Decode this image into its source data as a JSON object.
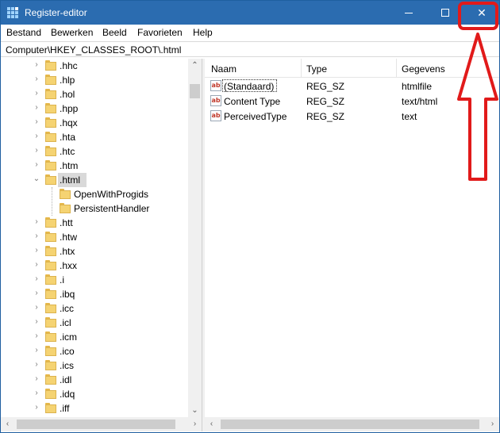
{
  "window": {
    "title": "Register-editor"
  },
  "titlebar": {
    "minimize_glyph": "",
    "maximize_glyph": "",
    "close_glyph": "✕"
  },
  "menu": {
    "items": [
      {
        "label": "Bestand"
      },
      {
        "label": "Bewerken"
      },
      {
        "label": "Beeld"
      },
      {
        "label": "Favorieten"
      },
      {
        "label": "Help"
      }
    ]
  },
  "address": {
    "path": "Computer\\HKEY_CLASSES_ROOT\\.html"
  },
  "tree": {
    "items": [
      {
        "label": ".hhc",
        "expander": "›"
      },
      {
        "label": ".hlp",
        "expander": "›"
      },
      {
        "label": ".hol",
        "expander": "›"
      },
      {
        "label": ".hpp",
        "expander": "›"
      },
      {
        "label": ".hqx",
        "expander": "›"
      },
      {
        "label": ".hta",
        "expander": "›"
      },
      {
        "label": ".htc",
        "expander": "›"
      },
      {
        "label": ".htm",
        "expander": "›"
      },
      {
        "label": ".html",
        "expander": "⌄",
        "selected": true
      },
      {
        "label": "OpenWithProgids",
        "expander": "",
        "child": true
      },
      {
        "label": "PersistentHandler",
        "expander": "",
        "child": true
      },
      {
        "label": ".htt",
        "expander": "›"
      },
      {
        "label": ".htw",
        "expander": "›"
      },
      {
        "label": ".htx",
        "expander": "›"
      },
      {
        "label": ".hxx",
        "expander": "›"
      },
      {
        "label": ".i",
        "expander": "›"
      },
      {
        "label": ".ibq",
        "expander": "›"
      },
      {
        "label": ".icc",
        "expander": "›"
      },
      {
        "label": ".icl",
        "expander": "›"
      },
      {
        "label": ".icm",
        "expander": "›"
      },
      {
        "label": ".ico",
        "expander": "›"
      },
      {
        "label": ".ics",
        "expander": "›"
      },
      {
        "label": ".idl",
        "expander": "›"
      },
      {
        "label": ".idq",
        "expander": "›"
      },
      {
        "label": ".iff",
        "expander": "›"
      }
    ]
  },
  "list": {
    "columns": [
      {
        "label": "Naam"
      },
      {
        "label": "Type"
      },
      {
        "label": "Gegevens"
      }
    ],
    "rows": [
      {
        "name": "(Standaard)",
        "type": "REG_SZ",
        "data": "htmlfile",
        "icon": "ab",
        "focused": true
      },
      {
        "name": "Content Type",
        "type": "REG_SZ",
        "data": "text/html",
        "icon": "ab"
      },
      {
        "name": "PerceivedType",
        "type": "REG_SZ",
        "data": "text",
        "icon": "ab"
      }
    ]
  },
  "scroll": {
    "up": "⌃",
    "down": "⌄",
    "left": "‹",
    "right": "›"
  },
  "colors": {
    "titlebar": "#2b6cb0",
    "annotation": "#e11a1a",
    "folder": "#f5d372",
    "selection": "#d9d9d9"
  }
}
